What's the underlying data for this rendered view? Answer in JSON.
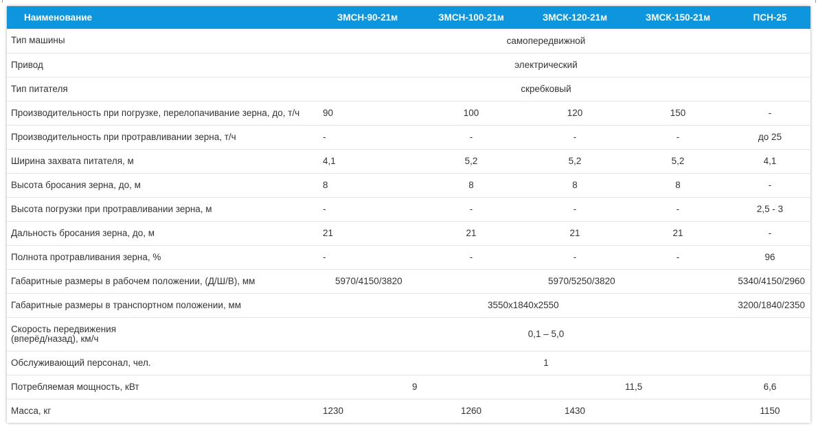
{
  "table": {
    "headers": [
      "Наименование",
      "ЗМСН-90-21м",
      "ЗМСН-100-21м",
      "ЗМСК-120-21м",
      "ЗМСК-150-21м",
      "ПСН-25"
    ],
    "rows": [
      {
        "label": "Тип машины",
        "all": "самопередвижной"
      },
      {
        "label": "Привод",
        "all": "электрический"
      },
      {
        "label": "Тип питателя",
        "all": "скребковый"
      },
      {
        "label": "Производительность при погрузке, перелопачивание зерна, до, т/ч",
        "values": [
          "90",
          "100",
          "120",
          "150",
          "-"
        ]
      },
      {
        "label": "Производительность при протравливании зерна, т/ч",
        "values": [
          "-",
          "-",
          "-",
          "-",
          "до 25"
        ]
      },
      {
        "label": "Ширина захвата питателя, м",
        "values": [
          "4,1",
          "5,2",
          "5,2",
          "5,2",
          "4,1"
        ]
      },
      {
        "label": "Высота бросания зерна, до, м",
        "values": [
          "8",
          "8",
          "8",
          "8",
          "-"
        ]
      },
      {
        "label": "Высота погрузки при протравливании зерна, м",
        "values": [
          "-",
          "-",
          "-",
          "-",
          "2,5 - 3"
        ]
      },
      {
        "label": "Дальность бросания зерна, до, м",
        "values": [
          "21",
          "21",
          "21",
          "21",
          "-"
        ]
      },
      {
        "label": "Полнота протравливания зерна, %",
        "values": [
          "-",
          "-",
          "-",
          "-",
          "96"
        ]
      },
      {
        "label": "Габаритные размеры в рабочем положении, (Д/Ш/В), мм",
        "values": [
          "5970/4150/3820",
          "5970/5250/3820",
          "5340/4150/2960"
        ]
      },
      {
        "label": "Габаритные размеры в транспортном положении, мм",
        "values": [
          "3550x1840x2550",
          "3200/1840/2350"
        ]
      },
      {
        "label_line1": "Скорость передвижения",
        "label_line2": "(вперёд/назад), км/ч",
        "all": "0,1 – 5,0"
      },
      {
        "label": "Обслуживающий персонал, чел.",
        "all": "1"
      },
      {
        "label": "Потребляемая мощность, кВт",
        "values": [
          "9",
          "11,5",
          "6,6"
        ]
      },
      {
        "label": "Масса, кг",
        "values": [
          "1230",
          "1260",
          "1430",
          "1150"
        ]
      }
    ]
  },
  "colors": {
    "header_bg": "#0d96dd",
    "header_text": "#ffffff",
    "row_border": "#e4e4e4"
  }
}
